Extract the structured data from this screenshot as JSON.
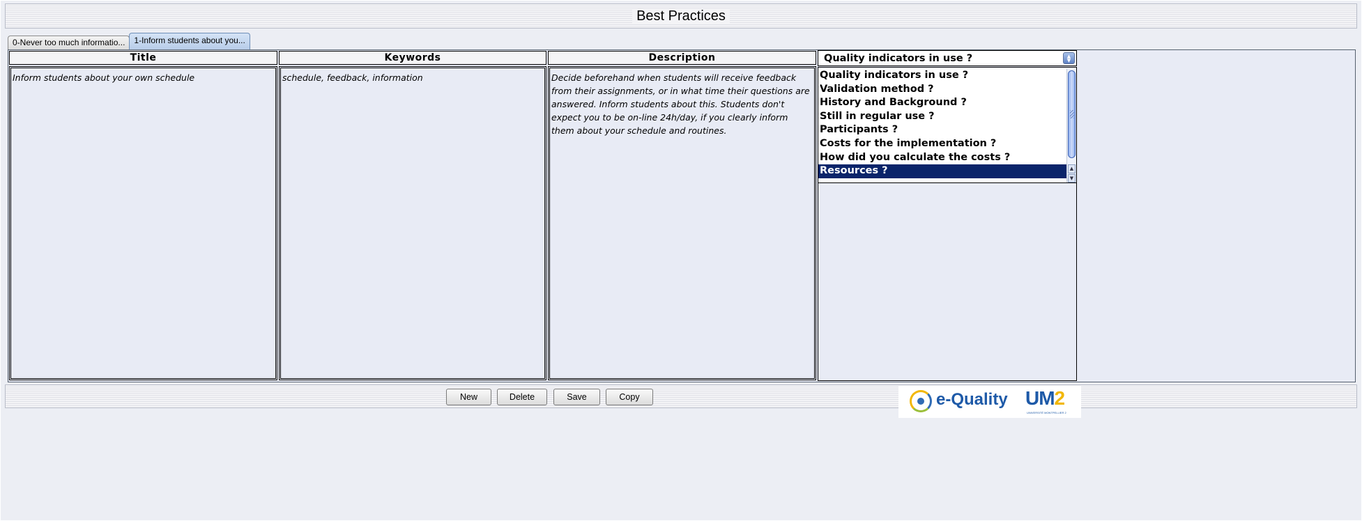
{
  "window": {
    "title": "Best Practices"
  },
  "tabs": [
    {
      "label": "0-Never too much informatio...",
      "active": false
    },
    {
      "label": "1-Inform students about you...",
      "active": true
    }
  ],
  "columns": {
    "title": {
      "header": "Title",
      "value": "Inform students about your own schedule"
    },
    "keywords": {
      "header": "Keywords",
      "value": "schedule, feedback, information"
    },
    "description": {
      "header": "Description",
      "value": "Decide beforehand when students will receive feedback from their assignments, or in what time their questions are answered. Inform students about this. Students don't expect you to be on-line 24h/day, if you clearly inform them about your schedule and routines."
    }
  },
  "question_select": {
    "selected": "Quality indicators in use ?",
    "items": [
      "Quality indicators in use ?",
      "Validation method ?",
      "History and Background ?",
      "Still in regular use ?",
      "Participants ?",
      "Costs for the implementation ?",
      "How did you calculate the costs ?",
      "Resources ?"
    ],
    "highlighted_index": 7
  },
  "buttons": {
    "new": "New",
    "delete": "Delete",
    "save": "Save",
    "copy": "Copy"
  },
  "logo": {
    "brand": "e-Quality",
    "partner": "UM",
    "partner_suffix": "2",
    "partner_subtitle": "UNIVERSITÉ MONTPELLIER 2"
  },
  "colors": {
    "panel_bg": "#e8ebf5",
    "selection": "#0a246a",
    "brand_blue": "#1e5aa8",
    "brand_yellow": "#f2b705"
  }
}
